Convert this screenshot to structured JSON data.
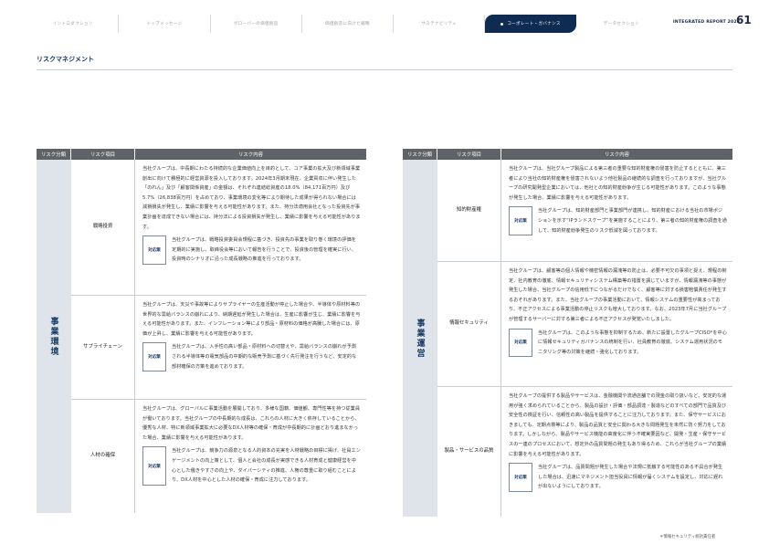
{
  "nav": {
    "tabs": [
      {
        "label": "イントロダクション",
        "active": false
      },
      {
        "label": "トップメッセージ",
        "active": false
      },
      {
        "label": "グローバーの価値創造",
        "active": false
      },
      {
        "label": "価値創造に向けた戦略",
        "active": false
      },
      {
        "label": "サステナビリティ",
        "active": false
      },
      {
        "label": "コーポレート・ガバナンス",
        "active": true
      },
      {
        "label": "データセクション",
        "active": false
      }
    ],
    "report_title": "INTEGRATED REPORT 2024",
    "page_number": "61",
    "active_color": "#0f2b52"
  },
  "section_title": "リスクマネジメント",
  "table_headers": {
    "category": "リスク分類",
    "item": "リスク項目",
    "content": "リスク内容"
  },
  "measure_label": "対応策",
  "left": {
    "category": "事業環境",
    "rows": [
      {
        "item": "戦略投資",
        "desc": "当社グループは、中長期にわたる持続的な企業価値向上を目的として、コア事業の拡大及び新領域事業創出に向けて積極的に経営資源を投入しております。2024年3月期末現在、企業買収に伴い発生した「のれん」及び「顧客関係資産」の金額は、それぞれ連結総資産の18.0%（84,171百万円）及び5.7%（26,838百万円）を占めており、事業環境の変化等により期待した成果が得られない場合には減損損失が発生し、業績に影響を与える可能性があります。また、持分法適用会社となった投資先が事業計画を達成できない場合には、持分法による投資損失が発生し、業績に影響を与える可能性があります。",
        "measure": "当社グループは、戦略投資委員会規程に基づき、投資先の事業を取り巻く環境の評価を定期的に実施し、取締役会等において報告を行うことで、投資後の管理を確実に行い、投資時のシナリオに沿った成長戦略の推進を行っております。"
      },
      {
        "item": "サプライチェーン",
        "desc": "当社グループは、天災や事故等によりサプライヤーの生産活動が停止した場合や、半導体や原材料等の世界的な需給バランスの崩れにより、納期遅延が発生した場合は、生産に影響が生じ、業績に影響を与える可能性があります。また、インフレーション等により部品・原材料の価格が高騰した場合には、原価が上昇し、業績に影響を与える可能性があります。",
        "measure": "当社グループは、入手性の高い部品・原材料への切替えや、需給バランスの崩れが予測される半導体等の電気部品の中期的な販売予測に基づく先行発注を行うなど、安定的な部材確保の方策を進めております。"
      },
      {
        "item": "人材の確保",
        "desc": "当社グループは、グローバルに事業活動を展開しており、多様な国籍、価値観、専門性等を持つ従業員が働いております。当社グループの中長期的な成長は、これらの人材に大きく依存していることから、優秀な人材、特に新領域事業拡大に必要なDX人材等の確保・育成が中長期的に計画どおり進まなかった場合、業績に影響を与える可能性があります。",
        "measure": "当社グループは、競争力の源泉となる人的資本の充実を人材戦略の目標に掲げ、社員エンゲージメントの向上策として、個人と会社の成長が実感できる人材育成と健康経営を中心とした働きやすさの向上や、ダイバーシティの推進、人権の尊重に取り組むことにより、DX人材を中心とした人材の確保・育成に注力しております。"
      }
    ]
  },
  "right": {
    "category": "事業運営",
    "rows": [
      {
        "item": "知的財産権",
        "desc": "当社グループは、当社グループ製品による第三者の重要な知的財産権の侵害を防止するとともに、第三者により当社の知的財産権を侵害されないよう他社製品の継続的な調査を行っておりますが、当社グループの研究開発型企業においては、他社との知的財産紛争が生じる可能性があります。このような事態が発生した場合、業績に影響を与える可能性があります。",
        "measure": "当社グループは、知的財産部門と事業部門が連携し、知的財産における当社の市場ポジションを示す“IPランドスケープ”を実施することにより、第三者の知的財産権の調査を通して、知的財産紛争発生のリスク低減を図っております。"
      },
      {
        "item": "情報セキュリティ",
        "desc": "当社グループは、顧客等の個人情報や機密情報の漏洩等の防止は、必要不可欠の事項と捉え、規程の制定、社内教育の徹底、情報セキュリティシステム構築等の措置を講じていますが、情報漏洩等の事態が発生した場合、当社グループの信用低下につながるだけでなく、顧客等に対する損害賠償責任が発生するおそれがあります。また、当社グループの事業活動において、情報システムの重要性が高まっており、不正アクセスによる事業活動の停止リスクも増大しております。なお、2023年7月に当社グループが管理するサーバーに対する第三者による不正アクセスが発覚いたしました。",
        "measure": "当社グループは、このような事態を抑制するため、新たに設置したグループCISO*を中心に情報セキュリティガバナンスの統制を行い、社員教育の徹底、システム運用状況のモニタリング等の対策を継続・強化しております。"
      },
      {
        "item": "製品・サービスの品質",
        "desc": "当社グループの提供する製品やサービスは、金融機関や流通店舗での現金の取り扱いなど、安定的な運用が強く求められていることから、製品の設計・評価・部品調達・製造などのすべての部門で品質及び安全性の検証を行い、信頼性の高い製品を提供することに注力しております。また、保守サービスにおきましても、定期点検等により、製品の品質と安全に関わる大きな問題発生を未然に防ぐ努力をしております。しかしながら、製品やサービス機能の高度化に伴う不確実要因など、開発・生産・保守サービスの一連のプロセスにおいて、想定外の品質問題の発生もあり得るため、これらが当社グループの業績に影響を与える可能性があります。",
        "measure": "当社グループは、品質問題が発生した場合や法規に抵触する可能性のある不具合が発生した場合は、迅速にマネジメント担当役員に情報が届くシステムを設定し、対応に遅れが出ないようにしております。"
      }
    ]
  },
  "footnote": "＊情報セキュリティ統括責任者"
}
